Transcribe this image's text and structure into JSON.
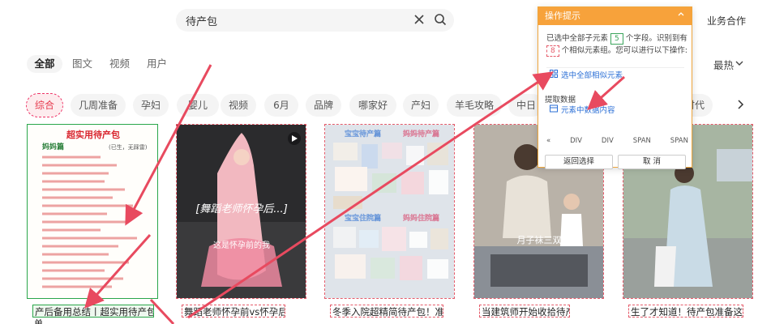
{
  "search": {
    "query": "待产包"
  },
  "header": {
    "business": "业务合作"
  },
  "tabs": [
    "全部",
    "图文",
    "视频",
    "用户"
  ],
  "sort": {
    "label": "最热"
  },
  "chips": [
    "综合",
    "几周准备",
    "孕妇",
    "婴儿",
    "视频",
    "6月",
    "品牌",
    "哪家好",
    "产妇",
    "羊毛攻略",
    "中日",
    "时代"
  ],
  "cards": [
    {
      "caption": "产后备用总结丨超实用待产包",
      "caption2": "单",
      "list_title": "超实用待产包",
      "list_sub1": "妈妈篇",
      "list_sub2": "(已生，无踩雷)"
    },
    {
      "caption": "舞蹈老师怀孕前vs怀孕后",
      "overlay1": "[舞蹈老师怀孕后...]",
      "overlay2": "这是怀孕前的我"
    },
    {
      "caption": "冬季入院超精简待产包！准备这些就够了",
      "tag1": "宝宝待产篇",
      "tag2": "妈妈待产篇",
      "tag3": "宝宝住院篇",
      "tag4": "妈妈住院篇"
    },
    {
      "caption": "当建筑师开始收拾待产包",
      "overlay1": "月子袜三双"
    },
    {
      "caption": "生了才知道！待产包准备这些就够了"
    }
  ],
  "panel": {
    "title": "操作提示",
    "msg_a": "已选中全部子元素",
    "msg_num1": "5",
    "msg_b": "个字段。识别到有",
    "msg_num2": "8",
    "msg_c": "个相似元素组。您可以进行以下操作:",
    "opt1": "选中全部相似元素",
    "label": "提取数据",
    "opt2": "元素中数据内容",
    "crumbs": [
      "«",
      "DIV",
      "DIV",
      "SPAN",
      "SPAN"
    ],
    "btn_back": "返回选择",
    "btn_cancel": "取 消"
  },
  "colors": {
    "accent": "#e6394d",
    "panel": "#f7a23b",
    "select_green": "#2aa64a",
    "arrow": "#e84a5f"
  }
}
